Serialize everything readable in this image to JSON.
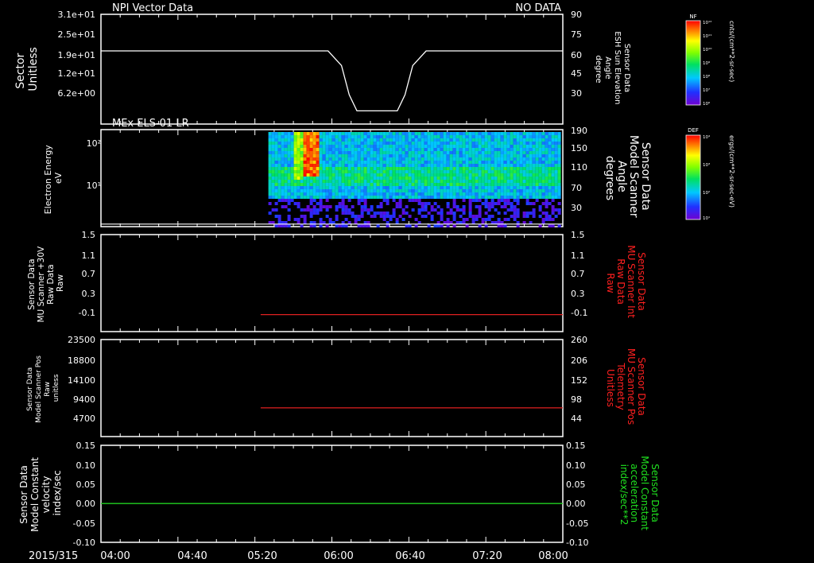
{
  "date_label": "2015/315",
  "time_ticks": [
    "04:00",
    "04:40",
    "05:20",
    "06:00",
    "06:40",
    "07:20",
    "08:00"
  ],
  "colors": {
    "foreground": "#ffffff",
    "red_line": "#e02020",
    "green_line": "#20d020",
    "red_label": "#ff2020",
    "green_label": "#20e020"
  },
  "chart_data": [
    {
      "type": "line",
      "title": "NPI Vector Data",
      "status": "NO DATA",
      "ylabel": [
        "Sector",
        "Unitless"
      ],
      "y_ticks": [
        "3.1e+01",
        "2.5e+01",
        "1.9e+01",
        "1.2e+01",
        "6.2e+00"
      ],
      "ylabel_right": [
        "Sensor Data",
        "ESH Sun Elevation",
        "Angle",
        "degree"
      ],
      "y_ticks_right": [
        "90",
        "75",
        "60",
        "45",
        "30"
      ],
      "ylim_right": [
        15,
        90
      ],
      "series": [
        {
          "color": "#ffffff",
          "x": [
            "04:00",
            "05:58",
            "06:05",
            "06:09",
            "06:13",
            "06:34",
            "06:38",
            "06:42",
            "06:49",
            "08:00"
          ],
          "y": [
            65,
            65,
            55,
            35,
            24,
            24,
            35,
            55,
            65,
            65
          ]
        }
      ]
    },
    {
      "type": "heatmap",
      "title": "MEx ELS-01 LR",
      "ylabel": [
        "Electron Energy",
        "eV"
      ],
      "y_ticks": [
        "10²",
        "10¹"
      ],
      "ylabel_right": [
        "Sensor Data",
        "Model Scanner",
        "Angle",
        "degrees"
      ],
      "y_ticks_right": [
        "190",
        "150",
        "110",
        "70",
        "30"
      ],
      "data_start": "05:27",
      "data_end": "07:58",
      "baseline_right_value": 5
    },
    {
      "type": "line",
      "ylabel": [
        "Sensor Data",
        "MU Scanner +30V",
        "Raw Data",
        "Raw"
      ],
      "y_ticks": [
        "1.5",
        "1.1",
        "0.7",
        "0.3",
        "-0.1"
      ],
      "ylim": [
        -0.35,
        1.5
      ],
      "ylabel_right": [
        "Sensor Data",
        "MU Scanner Int",
        "Raw Data",
        "Raw"
      ],
      "y_ticks_right": [
        "1.5",
        "1.1",
        "0.7",
        "0.3",
        "-0.1"
      ],
      "series": [
        {
          "color": "#e02020",
          "x": [
            "05:23",
            "08:00"
          ],
          "y": [
            -0.025,
            -0.025
          ]
        }
      ]
    },
    {
      "type": "line",
      "ylabel": [
        "Sensor Data",
        "Model Scanner Pos",
        "Raw",
        "unitless"
      ],
      "y_ticks": [
        "23500",
        "18800",
        "14100",
        "9400",
        "4700"
      ],
      "ylim": [
        0,
        23500
      ],
      "ylabel_right": [
        "Sensor Data",
        "MU Scanner Pos",
        "Telemetry",
        "Unitless"
      ],
      "y_ticks_right": [
        "260",
        "206",
        "152",
        "98",
        "44"
      ],
      "ylim_right": [
        0,
        260
      ],
      "series": [
        {
          "color": "#e02020",
          "x": [
            "05:23",
            "08:00"
          ],
          "y_right": [
            77,
            77
          ]
        }
      ]
    },
    {
      "type": "line",
      "ylabel": [
        "Sensor Data",
        "Model Constant",
        "velocity",
        "index/sec"
      ],
      "y_ticks": [
        "0.15",
        "0.10",
        "0.05",
        "0.00",
        "-0.05",
        "-0.10"
      ],
      "ylim": [
        -0.1,
        0.15
      ],
      "ylabel_right": [
        "Sensor Data",
        "Model Constant",
        "acceleration",
        "index/sec**2"
      ],
      "y_ticks_right": [
        "0.15",
        "0.10",
        "0.05",
        "0.00",
        "-0.05",
        "-0.10"
      ],
      "series": [
        {
          "color": "#20d020",
          "x": [
            "04:00",
            "08:00"
          ],
          "y": [
            0,
            0
          ]
        }
      ]
    }
  ],
  "colorbars": [
    {
      "label": "NF",
      "unit": "cnts/(cm**2-sr-sec)",
      "ticks": [
        "10¹²",
        "10¹¹",
        "10¹⁰",
        "10⁹",
        "10⁸",
        "10⁷",
        "10⁶"
      ]
    },
    {
      "label": "DEF",
      "unit": "ergs/(cm**2-sr-sec-eV)",
      "ticks": [
        "10⁴",
        "10³",
        "10²",
        "10¹"
      ]
    }
  ]
}
